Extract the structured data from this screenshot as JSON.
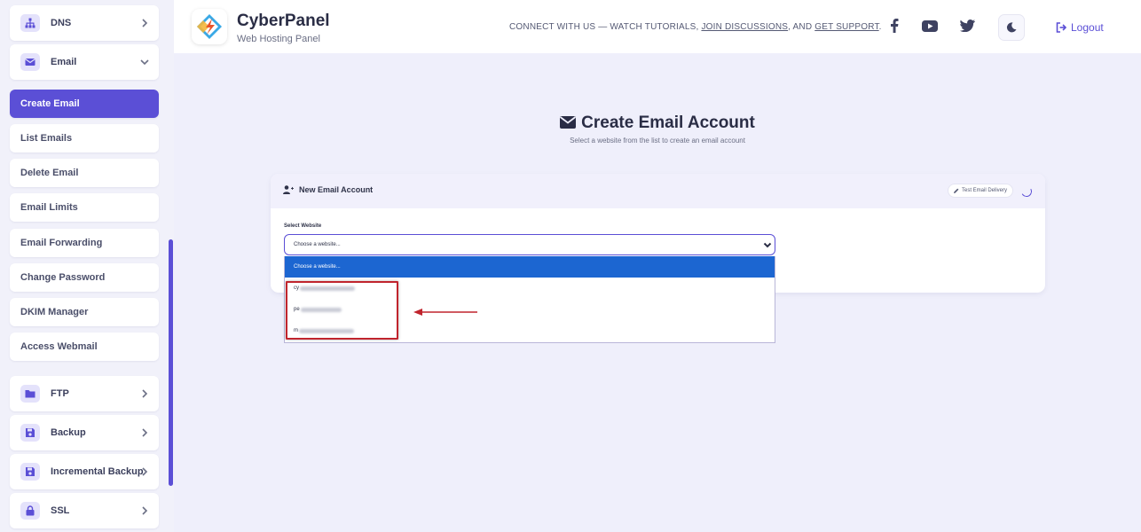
{
  "sidebar": {
    "groups_top": [
      {
        "label": "DNS",
        "icon": "sitemap-icon"
      },
      {
        "label": "Email",
        "icon": "envelope-icon"
      }
    ],
    "email_sub_items": [
      {
        "label": "Create Email",
        "active": true
      },
      {
        "label": "List Emails"
      },
      {
        "label": "Delete Email"
      },
      {
        "label": "Email Limits"
      },
      {
        "label": "Email Forwarding"
      },
      {
        "label": "Change Password"
      },
      {
        "label": "DKIM Manager"
      },
      {
        "label": "Access Webmail"
      }
    ],
    "groups_bottom": [
      {
        "label": "FTP",
        "icon": "folder-icon"
      },
      {
        "label": "Backup",
        "icon": "save-icon"
      },
      {
        "label": "Incremental Backup",
        "icon": "save-icon"
      },
      {
        "label": "SSL",
        "icon": "lock-icon"
      }
    ],
    "accent_color": "#5b4fd6"
  },
  "header": {
    "brand_name": "CyberPanel",
    "brand_sub": "Web Hosting Panel",
    "connect_prefix": "CONNECT WITH US — WATCH TUTORIALS, ",
    "connect_link1": "JOIN DISCUSSIONS",
    "connect_mid": ", AND ",
    "connect_link2": "GET SUPPORT",
    "connect_suffix": ".",
    "social_icons": [
      "facebook-icon",
      "youtube-icon",
      "twitter-icon"
    ],
    "logout_label": "Logout"
  },
  "main": {
    "title": "Create Email Account",
    "subtitle": "Select a website from the list to create an email account",
    "card": {
      "title": "New Email Account",
      "test_button_label": "Test Email Delivery",
      "select_label": "Select Website",
      "select_value": "Choose a website...",
      "dropdown_options": [
        {
          "label": "Choose a website...",
          "selected": true
        },
        {
          "label": "cy"
        },
        {
          "label": "pe"
        },
        {
          "label": "m"
        }
      ]
    }
  },
  "annotation": {
    "highlight_color": "#c0242d"
  }
}
